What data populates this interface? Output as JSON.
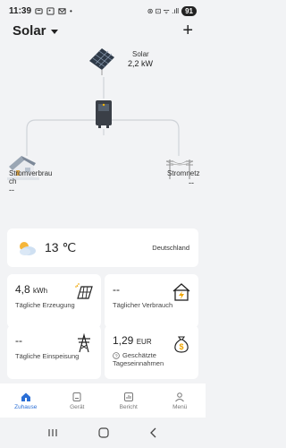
{
  "status": {
    "time": "11:39",
    "right_text": "⊛ ⊡ ᯤ .ıll",
    "battery": "91"
  },
  "header": {
    "title": "Solar"
  },
  "flow": {
    "solar_label": "Solar",
    "solar_value": "2,2 kW",
    "home_label": "Stromverbrauch",
    "home_value": "--",
    "grid_label": "Stromnetz",
    "grid_value": "--"
  },
  "weather": {
    "temp": "13 ℃",
    "location": "Deutschland"
  },
  "stats": {
    "daily_gen_value": "4,8",
    "daily_gen_unit": "kWh",
    "daily_gen_label": "Tägliche Erzeugung",
    "daily_use_value": "--",
    "daily_use_label": "Täglicher Verbrauch",
    "daily_feed_value": "--",
    "daily_feed_label": "Tägliche Einspeisung",
    "income_value": "1,29",
    "income_unit": "EUR",
    "income_label_1": "Geschätzte",
    "income_label_2": "Tageseinnahmen"
  },
  "tabs": [
    {
      "label": "Zuhause"
    },
    {
      "label": "Gerät"
    },
    {
      "label": "Bericht"
    },
    {
      "label": "Menü"
    }
  ],
  "colors": {
    "accent": "#2b6fd6",
    "background": "#f2f3f5"
  }
}
